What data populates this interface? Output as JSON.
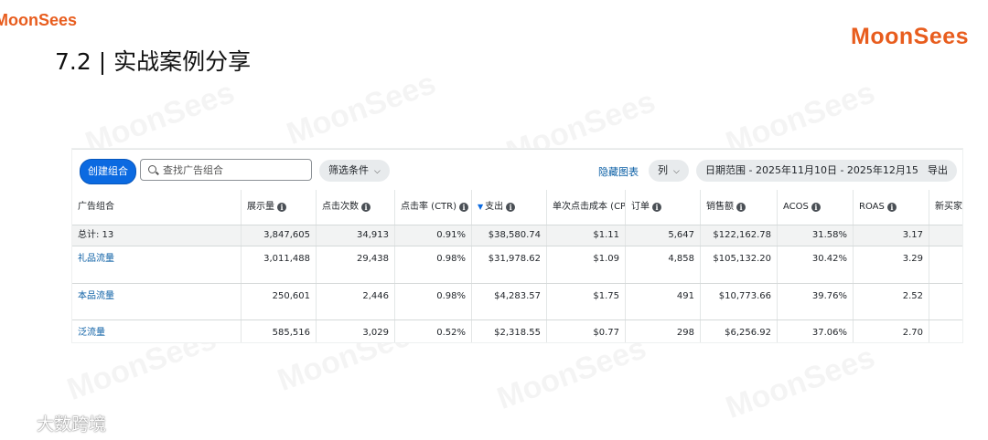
{
  "brand": {
    "logo": "MoonSees"
  },
  "slide": {
    "title": "7.2 | 实战案例分享"
  },
  "toolbar": {
    "create_label": "创建组合",
    "search_placeholder": "查找广告组合",
    "filter_label": "筛选条件",
    "hide_chart_label": "隐藏图表",
    "columns_label": "列",
    "date_range_label": "日期范围 - 2025年11月10日 - 2025年12月15日",
    "export_label": "导出"
  },
  "table": {
    "headers": [
      "广告组合",
      "展示量",
      "点击次数",
      "点击率 (CTR)",
      "支出",
      "单次点击成本 (CPC)",
      "订单",
      "销售额",
      "ACOS",
      "ROAS",
      "新买家"
    ],
    "total": [
      "总计: 13",
      "3,847,605",
      "34,913",
      "0.91%",
      "$38,580.74",
      "$1.11",
      "5,647",
      "$122,162.78",
      "31.58%",
      "3.17",
      ""
    ],
    "rows": [
      [
        "礼品流量",
        "3,011,488",
        "29,438",
        "0.98%",
        "$31,978.62",
        "$1.09",
        "4,858",
        "$105,132.20",
        "30.42%",
        "3.29",
        ""
      ],
      [
        "本品流量",
        "250,601",
        "2,446",
        "0.98%",
        "$4,283.57",
        "$1.75",
        "491",
        "$10,773.66",
        "39.76%",
        "2.52",
        ""
      ],
      [
        "泛流量",
        "585,516",
        "3,029",
        "0.52%",
        "$2,318.55",
        "$0.77",
        "298",
        "$6,256.92",
        "37.06%",
        "2.70",
        ""
      ]
    ]
  },
  "footer": {
    "logo_text": "大数跨境"
  },
  "colors": {
    "brand": "#e85d1e",
    "primary": "#0b6ae1",
    "link": "#0b5fa5"
  }
}
